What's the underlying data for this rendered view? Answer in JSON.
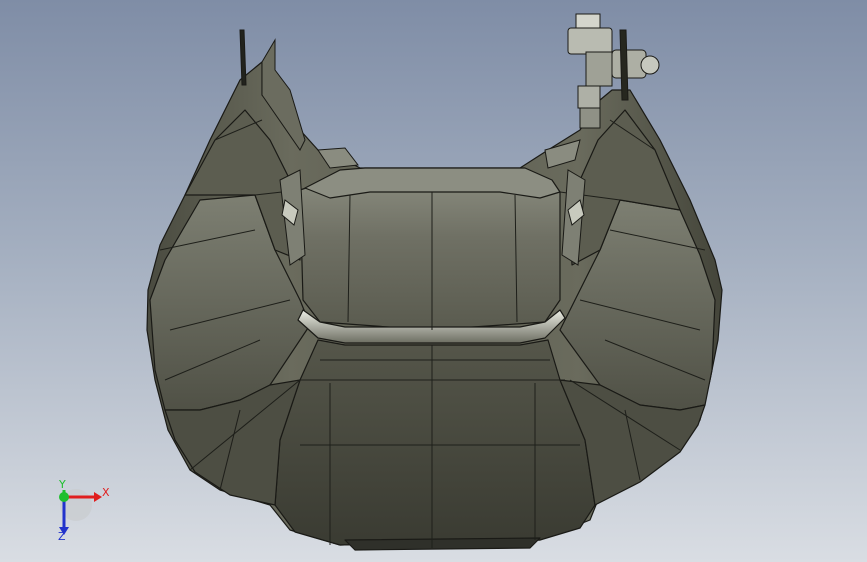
{
  "viewport": {
    "background_top": "#7f8da6",
    "background_bottom": "#d9dde3",
    "model": {
      "body_color": "#5e5f52",
      "shade_color": "#3f4036",
      "highlight_color": "#c9cbc0",
      "edge_color": "#1a1a16"
    }
  },
  "triad": {
    "x_label": "X",
    "y_label": "Y",
    "z_label": "Z",
    "x_color": "#e01e1e",
    "y_color": "#1fbf2e",
    "z_color": "#2233cc"
  }
}
